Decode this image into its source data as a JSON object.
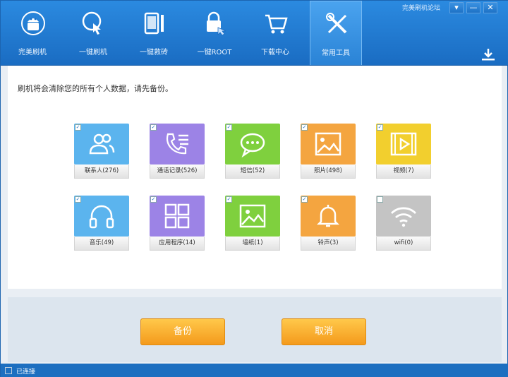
{
  "window": {
    "brand_link": "完美刷机论坛",
    "buttons": [
      "▾",
      "—",
      "✕"
    ]
  },
  "nav": [
    {
      "label": "完美刷机",
      "icon": "android-icon"
    },
    {
      "label": "一键刷机",
      "icon": "touch-circle-icon"
    },
    {
      "label": "一键救砖",
      "icon": "phone-tools-icon"
    },
    {
      "label": "一键ROOT",
      "icon": "lock-hand-icon"
    },
    {
      "label": "下载中心",
      "icon": "cart-icon"
    },
    {
      "label": "常用工具",
      "icon": "tools-icon"
    }
  ],
  "notice": "刷机将会清除您的所有个人数据，请先备份。",
  "tiles": [
    {
      "label": "联系人(276)",
      "color": "#5bb4ee",
      "icon": "contacts-icon",
      "checked": true
    },
    {
      "label": "通话记录(526)",
      "color": "#9c83e6",
      "icon": "call-log-icon",
      "checked": true
    },
    {
      "label": "短信(52)",
      "color": "#7fd03e",
      "icon": "sms-icon",
      "checked": true
    },
    {
      "label": "照片(498)",
      "color": "#f4a540",
      "icon": "photo-icon",
      "checked": true
    },
    {
      "label": "视频(7)",
      "color": "#f2cf2e",
      "icon": "video-icon",
      "checked": true
    },
    {
      "label": "音乐(49)",
      "color": "#5bb4ee",
      "icon": "headphones-icon",
      "checked": true
    },
    {
      "label": "应用程序(14)",
      "color": "#9c83e6",
      "icon": "apps-grid-icon",
      "checked": true
    },
    {
      "label": "墙纸(1)",
      "color": "#7fd03e",
      "icon": "wallpaper-icon",
      "checked": true
    },
    {
      "label": "铃声(3)",
      "color": "#f4a540",
      "icon": "bell-icon",
      "checked": true
    },
    {
      "label": "wifi(0)",
      "color": "#c4c4c4",
      "icon": "wifi-icon",
      "checked": false
    }
  ],
  "buttons": {
    "backup": "备份",
    "cancel": "取消"
  },
  "status": "已连接"
}
